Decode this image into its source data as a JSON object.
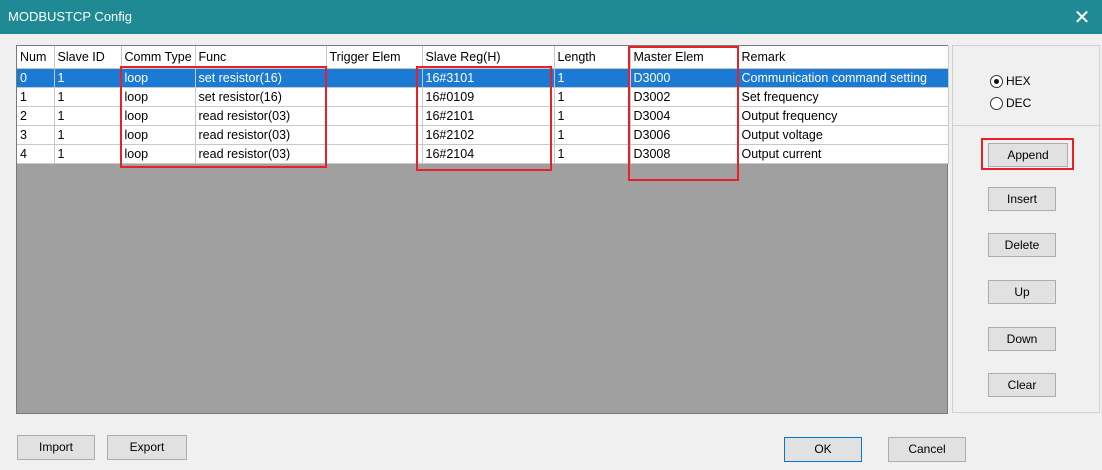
{
  "window": {
    "title": "MODBUSTCP Config",
    "close_glyph": "✕"
  },
  "grid": {
    "columns": [
      "Num",
      "Slave ID",
      "Comm Type",
      "Func",
      "Trigger Elem",
      "Slave Reg(H)",
      "Length",
      "Master Elem",
      "Remark"
    ],
    "rows": [
      [
        "0",
        "1",
        "loop",
        "set resistor(16)",
        "",
        "16#3101",
        "1",
        "D3000",
        "Communication command setting"
      ],
      [
        "1",
        "1",
        "loop",
        "set resistor(16)",
        "",
        "16#0109",
        "1",
        "D3002",
        "Set frequency"
      ],
      [
        "2",
        "1",
        "loop",
        "read resistor(03)",
        "",
        "16#2101",
        "1",
        "D3004",
        "Output frequency"
      ],
      [
        "3",
        "1",
        "loop",
        "read resistor(03)",
        "",
        "16#2102",
        "1",
        "D3006",
        "Output voltage"
      ],
      [
        "4",
        "1",
        "loop",
        "read resistor(03)",
        "",
        "16#2104",
        "1",
        "D3008",
        "Output current"
      ]
    ],
    "selected_row": 0
  },
  "format": {
    "hex_label": "HEX",
    "dec_label": "DEC",
    "selected": "HEX"
  },
  "side_buttons": {
    "append": "Append",
    "insert": "Insert",
    "delete": "Delete",
    "up": "Up",
    "down": "Down",
    "clear": "Clear"
  },
  "bottom_buttons": {
    "import": "Import",
    "export": "Export",
    "ok": "OK",
    "cancel": "Cancel"
  },
  "colors": {
    "titlebar": "#1f8a93",
    "selection": "#1a7ad4",
    "highlight": "#e8202a"
  }
}
